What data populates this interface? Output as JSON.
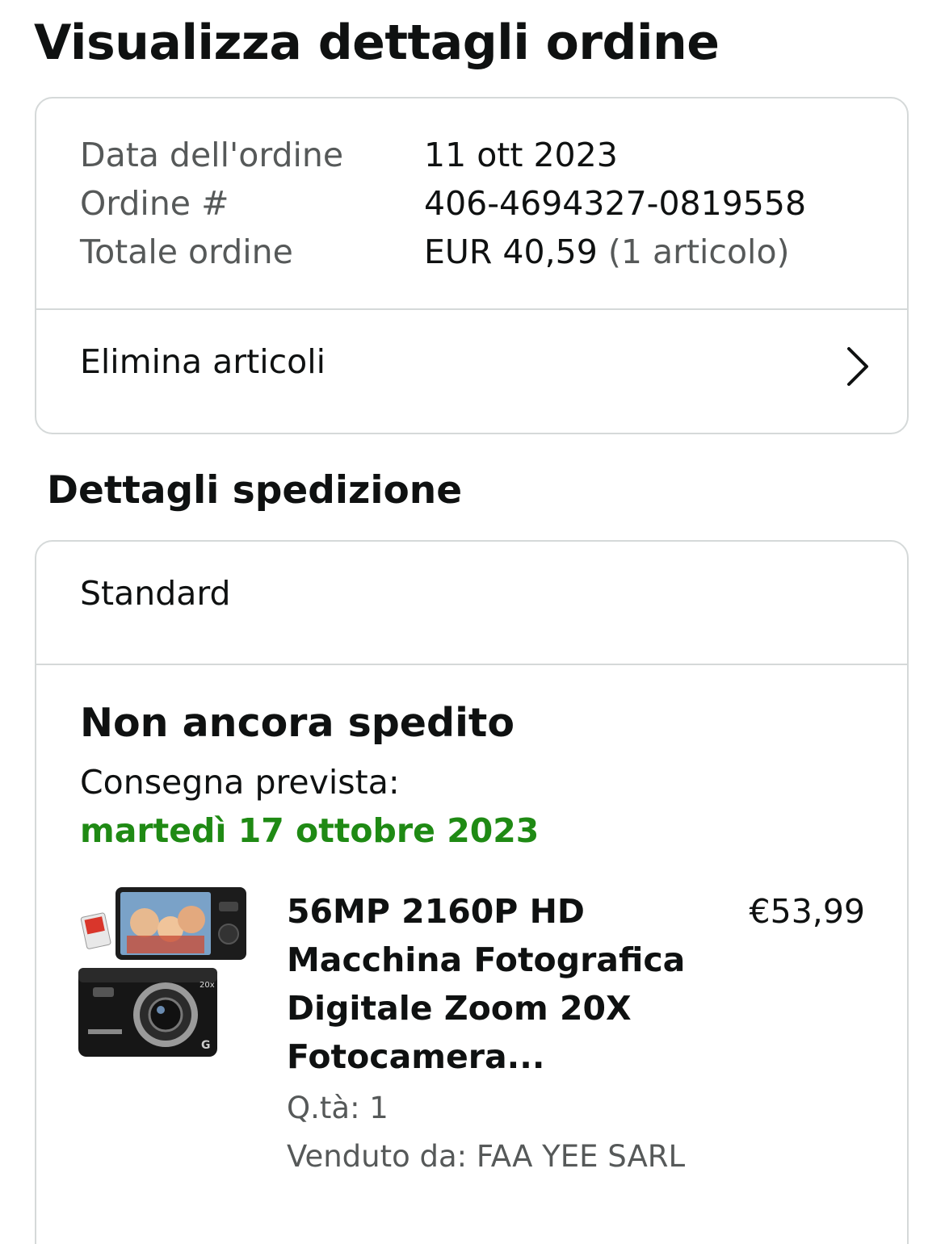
{
  "page": {
    "title": "Visualizza dettagli ordine"
  },
  "order_summary": {
    "rows": [
      {
        "label": "Data dell'ordine",
        "value": "11 ott 2023"
      },
      {
        "label": "Ordine #",
        "value": "406-4694327-0819558"
      },
      {
        "label": "Totale ordine",
        "value": "EUR 40,59",
        "value_suffix": "(1 articolo)"
      }
    ],
    "action_label": "Elimina articoli",
    "action_icon": "chevron-right-icon"
  },
  "shipping": {
    "heading": "Dettagli spedizione",
    "method": "Standard",
    "status": "Non ancora spedito",
    "delivery_label": "Consegna prevista:",
    "delivery_date": "martedì 17 ottobre 2023",
    "delivery_date_color": "#1f8a14",
    "item": {
      "image_icon": "digital-camera-product-image",
      "title": "56MP 2160P HD Macchina Fotografica Digitale Zoom 20X Fotocamera...",
      "price": "€53,99",
      "quantity": "Q.tà: 1",
      "seller": "Venduto da: FAA YEE SARL"
    }
  },
  "colors": {
    "text": "#0f1111",
    "muted_text": "#565959",
    "border": "#d5d9d9",
    "delivery_green": "#1f8a14"
  }
}
